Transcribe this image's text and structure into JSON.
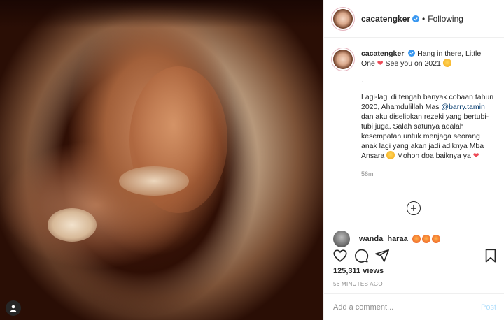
{
  "post": {
    "username": "cacatengker",
    "follow_status": "Following",
    "separator": "•"
  },
  "caption": {
    "username": "cacatengker",
    "line1_a": "Hang in there, Little One",
    "line1_b": "See you on 2021",
    "dot_line": ".",
    "para_a": "Lagi-lagi di tengah banyak cobaan tahun 2020, Ahamdulillah Mas",
    "mention": "@barry.tamin",
    "para_b": "dan aku diselipkan rezeki yang bertubi-tubi juga. Salah satunya adalah kesempatan untuk menjaga seorang anak lagi yang akan jadi adiknya Mba Ansara",
    "para_c": "Mohon doa baiknya ya",
    "time": "56m"
  },
  "comment": {
    "username": "wanda_haraa"
  },
  "stats": {
    "views": "125,311 views",
    "posted_ago": "56 MINUTES AGO"
  },
  "compose": {
    "placeholder": "Add a comment...",
    "post_label": "Post"
  },
  "icons": {
    "tag": "person-tag-icon",
    "verified": "verified-badge-icon",
    "heart": "heart-icon",
    "comment": "comment-icon",
    "share": "share-icon",
    "save": "bookmark-icon",
    "more": "plus-circle-icon"
  },
  "colors": {
    "verified": "#3897f0",
    "heart_emoji": "#ed4956",
    "post_disabled": "#b2dffc",
    "muted_text": "#8e8e8e"
  }
}
